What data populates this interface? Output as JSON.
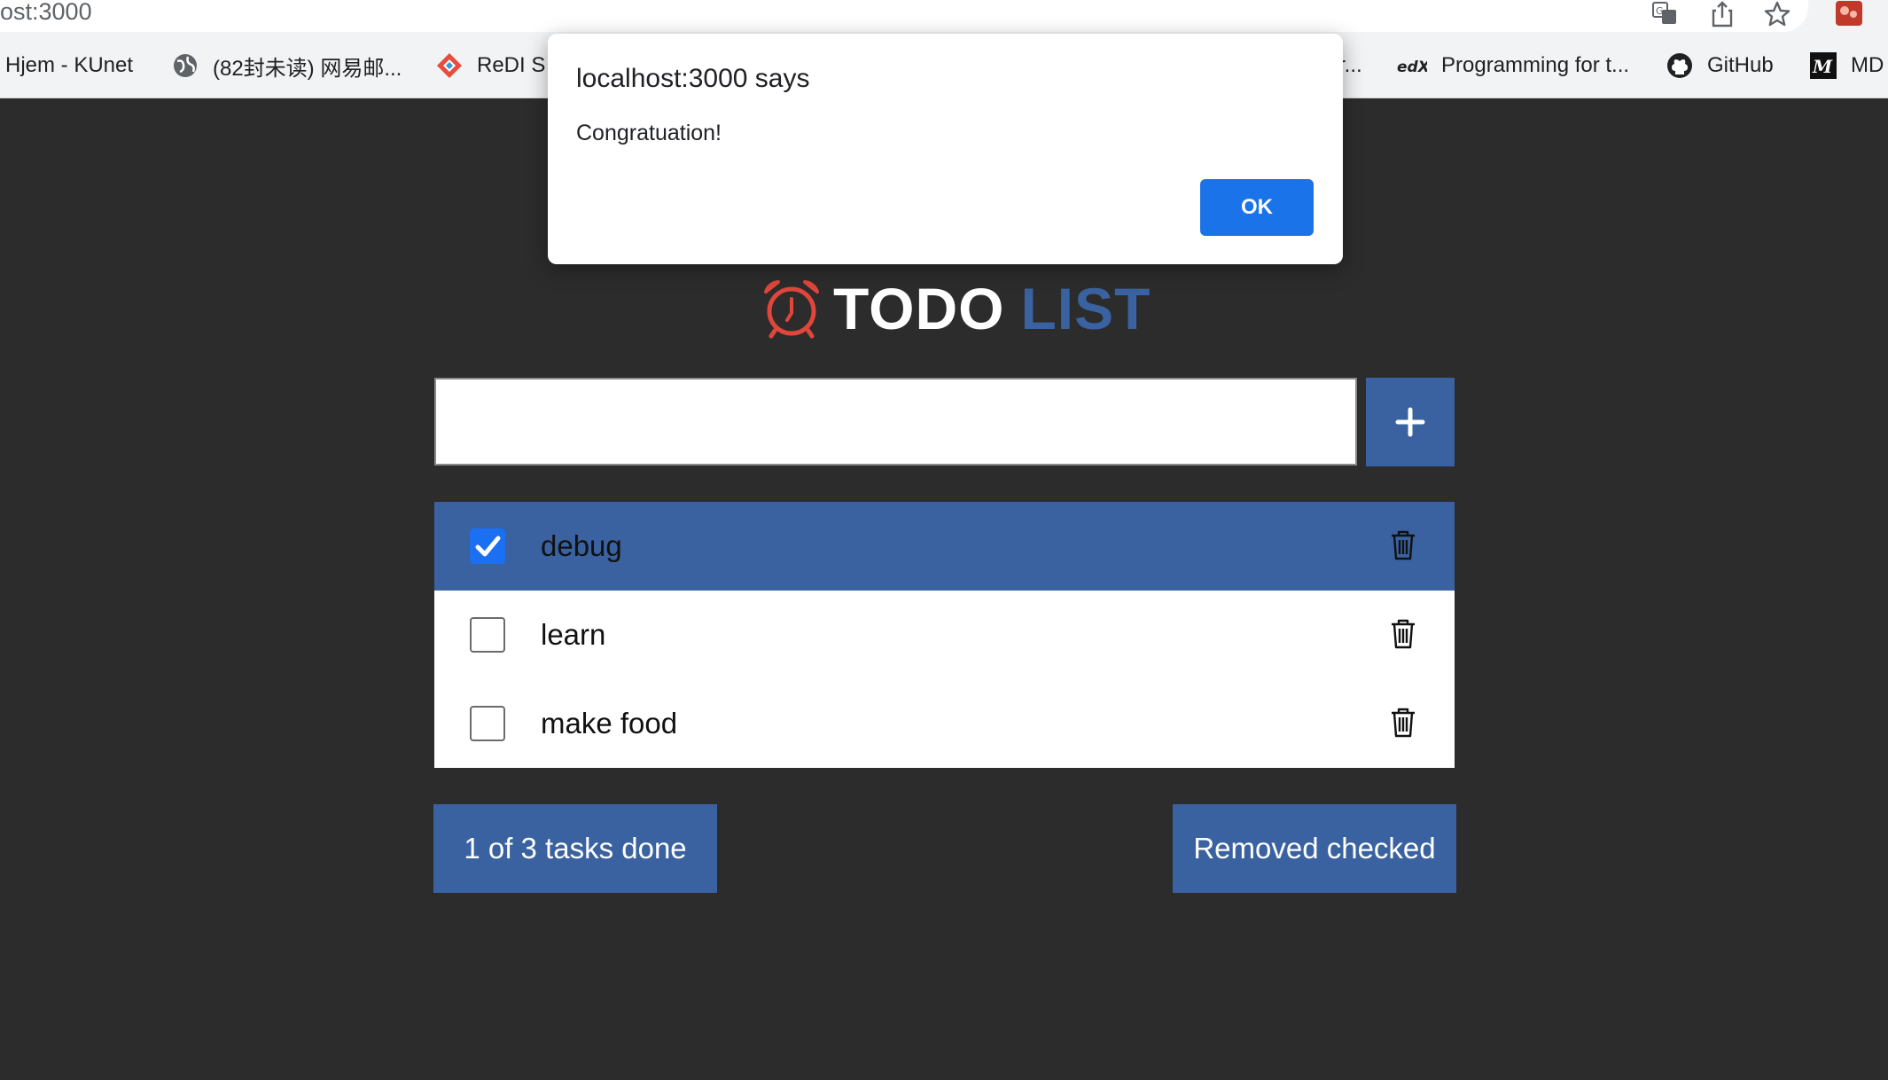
{
  "browser": {
    "url_fragment": "ost:3000",
    "icons": [
      "translate-icon",
      "share-icon",
      "star-icon",
      "extension-icon"
    ],
    "bookmarks": [
      {
        "label": "Hjem - KUnet",
        "icon": "none"
      },
      {
        "label": "(82封未读) 网易邮...",
        "icon": "globe-icon"
      },
      {
        "label": "ReDI S",
        "icon": "redi-icon"
      },
      {
        "label": "r...",
        "icon": "none"
      },
      {
        "label": "Programming for t...",
        "icon": "edx-icon"
      },
      {
        "label": "GitHub",
        "icon": "github-icon"
      },
      {
        "label": "MD",
        "icon": "medium-icon"
      }
    ]
  },
  "dialog": {
    "title": "localhost:3000 says",
    "message": "Congratuation!",
    "ok_label": "OK"
  },
  "app": {
    "title_part1": "TODO",
    "title_part2": "LIST",
    "title_icon": "alarm-clock-icon",
    "input": {
      "value": "",
      "placeholder": ""
    },
    "add_button_icon": "plus-icon",
    "todos": [
      {
        "text": "debug",
        "checked": true
      },
      {
        "text": "learn",
        "checked": false
      },
      {
        "text": "make food",
        "checked": false
      }
    ],
    "status_text": "1 of 3 tasks done",
    "remove_label": "Removed checked"
  },
  "colors": {
    "background": "#2c2c2c",
    "accent": "#3a62a0",
    "checkbox_checked": "#1a6ff2",
    "title_icon": "#e0463a",
    "dialog_button": "#1a73e8"
  }
}
